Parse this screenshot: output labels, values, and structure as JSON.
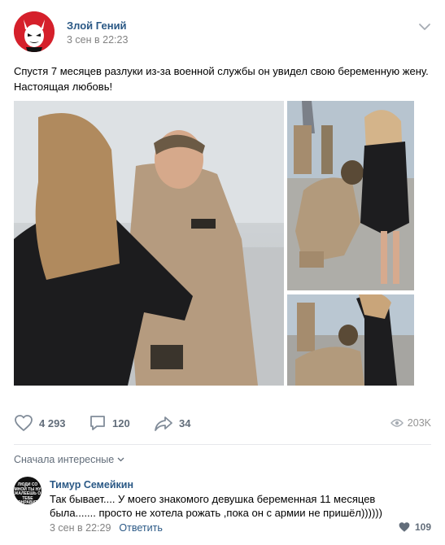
{
  "post": {
    "author": "Злой Гений",
    "date": "3 сен в 22:23",
    "text": "Спустя 7 месяцев разлуки из-за военной службы он увидел свою беременную жену. Настоящая любовь!"
  },
  "actions": {
    "likes": "4 293",
    "comments": "120",
    "shares": "34",
    "views": "203K"
  },
  "comments_section": {
    "sort_label": "Сначала интересные",
    "items": [
      {
        "author": "Тимур Семейкин",
        "avatar_text": "ЛЮДИ СО МНОЙ ТЫ НУ ЖАЛЕЕШЬ О ТЕБЕ ОНРАВИТ",
        "text": "Так бывает.... У моего знакомого девушка беременная 11 месяцев была....... просто не хотела рожать ,пока он с армии не пришёл))))))",
        "date": "3 сен в 22:29",
        "reply_label": "Ответить",
        "likes": "109"
      }
    ]
  },
  "colors": {
    "link": "#2a5885",
    "secondary_text": "#828282",
    "action_gray": "#626d7a",
    "avatar_red": "#d5202b"
  },
  "icons": [
    "devil-avatar-icon",
    "chevron-down-icon",
    "heart-icon",
    "comment-icon",
    "share-arrow-icon",
    "eye-icon"
  ]
}
